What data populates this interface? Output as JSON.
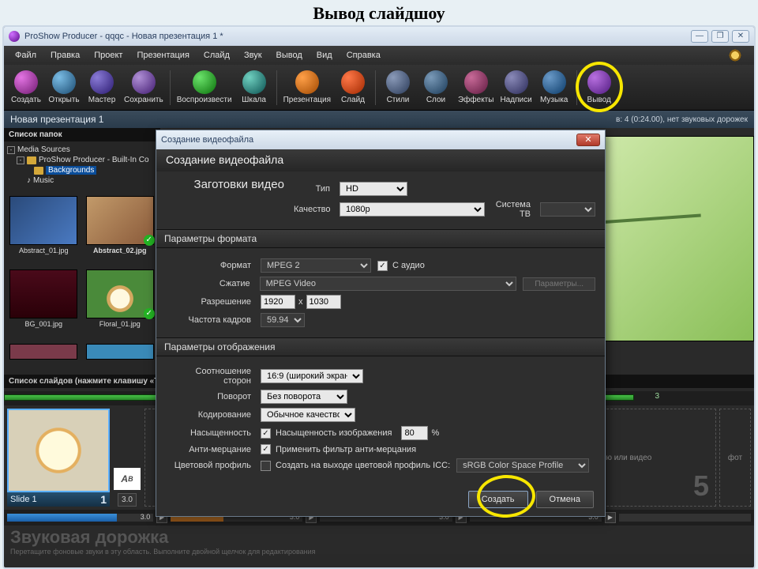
{
  "page_title": "Вывод слайдшоу",
  "window": {
    "title": "ProShow Producer - qqqc - Новая презентация 1 *",
    "min": "—",
    "max": "❐",
    "close": "✕"
  },
  "menu": [
    "Файл",
    "Правка",
    "Проект",
    "Презентация",
    "Слайд",
    "Звук",
    "Вывод",
    "Вид",
    "Справка"
  ],
  "toolbar": [
    {
      "id": "create",
      "label": "Создать"
    },
    {
      "id": "open",
      "label": "Открыть"
    },
    {
      "id": "wizard",
      "label": "Мастер"
    },
    {
      "id": "save",
      "label": "Сохранить"
    },
    {
      "sep": true
    },
    {
      "id": "play",
      "label": "Воспроизвести"
    },
    {
      "id": "scale",
      "label": "Шкала"
    },
    {
      "sep": true
    },
    {
      "id": "pres",
      "label": "Презентация"
    },
    {
      "id": "slide",
      "label": "Слайд"
    },
    {
      "sep": true
    },
    {
      "id": "styles",
      "label": "Стили"
    },
    {
      "id": "layers",
      "label": "Слои"
    },
    {
      "id": "effects",
      "label": "Эффекты"
    },
    {
      "id": "captions",
      "label": "Надписи"
    },
    {
      "id": "music",
      "label": "Музыка"
    },
    {
      "sep": true
    },
    {
      "id": "output",
      "label": "Вывод",
      "highlight": true
    }
  ],
  "pres_header": {
    "name": "Новая презентация 1",
    "info": "в: 4 (0:24.00), нет звуковых дорожек"
  },
  "folders": {
    "title": "Список папок",
    "root": "Media Sources",
    "sub": "ProShow Producer - Built-In Co",
    "sel": "Backgrounds",
    "music": "Music"
  },
  "thumbs": [
    {
      "name": "Abstract_01.jpg"
    },
    {
      "name": "Abstract_02.jpg",
      "chk": true,
      "sel": true
    },
    {
      "name": "BG_001.jpg"
    },
    {
      "name": "Floral_01.jpg",
      "chk": true
    }
  ],
  "slidelist_hint": "Список слайдов (нажмите клавишу «Tab",
  "progress_num": "3",
  "slide1": {
    "name": "Slide 1",
    "num": "1",
    "dur": "3.0",
    "trans": "3.0"
  },
  "placeholders": {
    "drag": "Перетащите сюда фотографию или видео",
    "n5": "5",
    "small": "фот"
  },
  "timeline_vals": [
    "3.0",
    "3.0",
    "3.0",
    "3.0"
  ],
  "audio": {
    "title": "Звуковая дорожка",
    "hint": "Перетащите фоновые звуки в эту область. Выполните двойной щелчок для редактирования"
  },
  "dialog": {
    "titlebar": "Создание видеофайла",
    "header": "Создание видеофайла",
    "presets": "Заготовки видео",
    "type_l": "Тип",
    "type_v": "HD",
    "quality_l": "Качество",
    "quality_v": "1080p",
    "tv_l": "Система ТВ",
    "tv_v": "",
    "sect_format": "Параметры формата",
    "format_l": "Формат",
    "format_v": "MPEG 2",
    "audio_chk": "С аудио",
    "compress_l": "Сжатие",
    "compress_v": "MPEG Video",
    "params_btn": "Параметры...",
    "res_l": "Разрешение",
    "res_w": "1920",
    "res_x": "x",
    "res_h": "1030",
    "fps_l": "Частота кадров",
    "fps_v": "59.94",
    "sect_display": "Параметры отображения",
    "aspect_l": "Соотношение сторон",
    "aspect_v": "16:9 (широкий экран)",
    "rotate_l": "Поворот",
    "rotate_v": "Без поворота",
    "encode_l": "Кодирование",
    "encode_v": "Обычное качество",
    "sat_l": "Насыщенность",
    "sat_chk": "Насыщенность изображения",
    "sat_v": "80",
    "sat_pct": "%",
    "flicker_l": "Анти-мерцание",
    "flicker_chk": "Применить фильтр анти-мерцания",
    "icc_l": "Цветовой профиль",
    "icc_chk": "Создать на выходе цветовой профиль ICC:",
    "icc_v": "sRGB Color Space Profile",
    "create_btn": "Создать",
    "cancel_btn": "Отмена"
  }
}
